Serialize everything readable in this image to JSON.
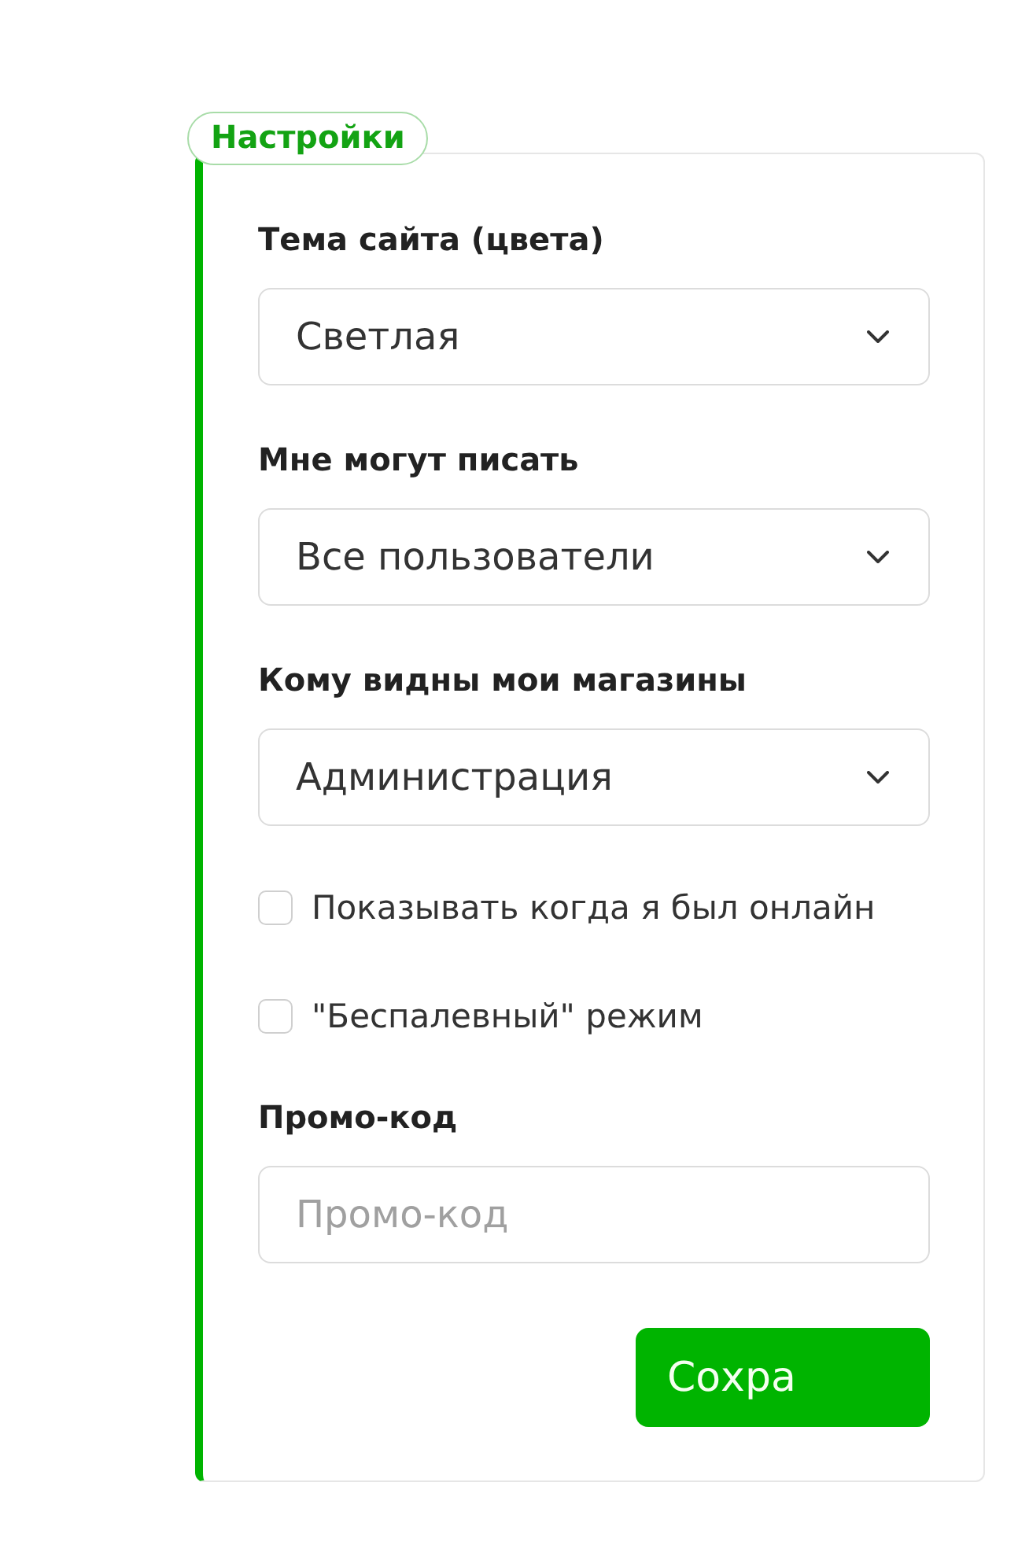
{
  "section": {
    "title": "Настройки"
  },
  "fields": [
    {
      "kind": "select",
      "label": "Тема сайта (цвета)",
      "value": "Светлая"
    },
    {
      "kind": "select",
      "label": "Мне могут писать",
      "value": "Все пользователи"
    },
    {
      "kind": "select",
      "label": "Кому видны мои магазины",
      "value": "Администрация"
    },
    {
      "kind": "checkbox",
      "label": "Показывать когда я был онлайн",
      "checked": false
    },
    {
      "kind": "checkbox",
      "label": "\"Беспалевный\" режим",
      "checked": false
    },
    {
      "kind": "input",
      "label": "Промо-код",
      "placeholder": "Промо-код"
    }
  ],
  "buttons": [
    {
      "label": "Сохра"
    }
  ]
}
